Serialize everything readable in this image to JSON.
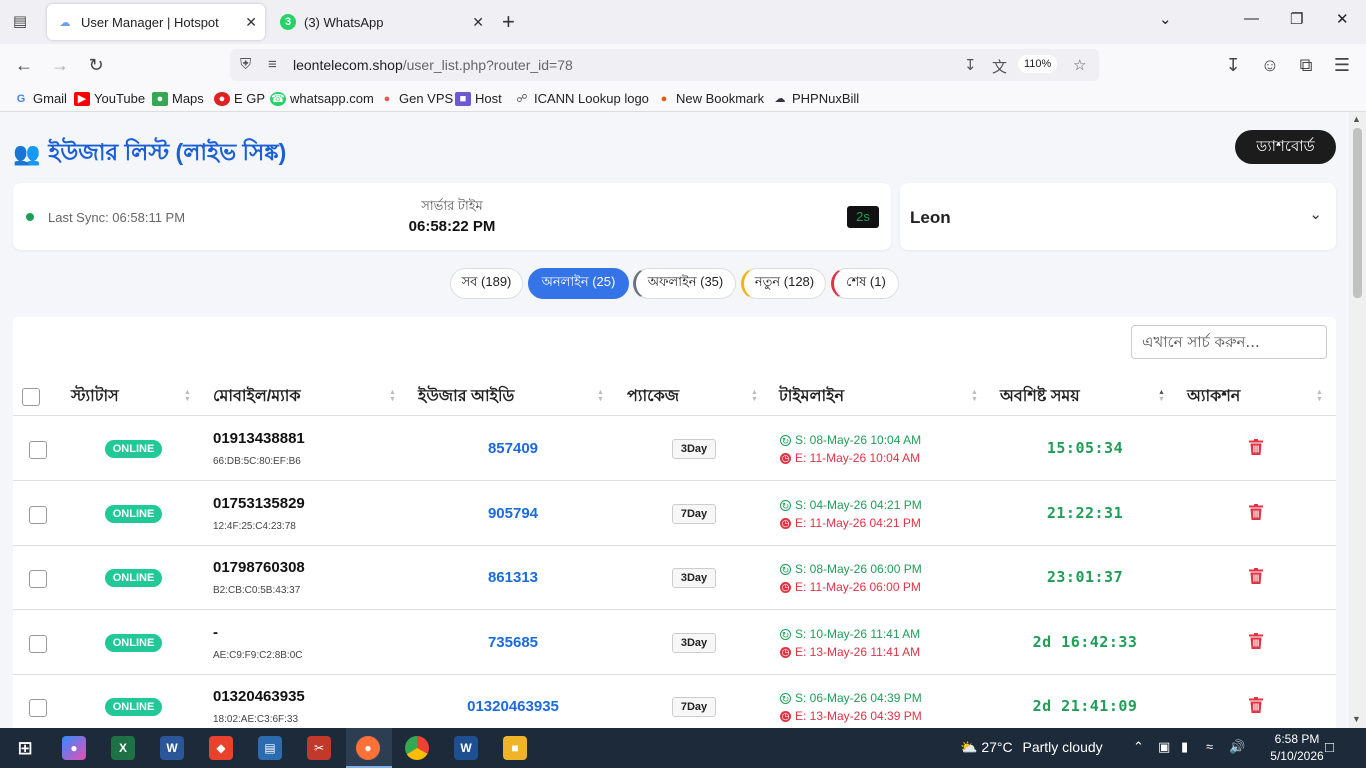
{
  "browser": {
    "tabs": [
      {
        "title": "User Manager | Hotspot",
        "active": true
      },
      {
        "title": "(3) WhatsApp",
        "badge": "3",
        "active": false
      }
    ],
    "url_host": "leontelecom.shop",
    "url_path": "/user_list.php?router_id=78",
    "zoom": "110%",
    "bookmarks": [
      "Gmail",
      "YouTube",
      "Maps",
      "E GP",
      "whatsapp.com",
      "Gen VPS",
      "Host",
      "ICANN Lookup logo",
      "New Bookmark",
      "PHPNuxBill"
    ]
  },
  "page": {
    "title": "ইউজার লিস্ট (লাইভ সিঙ্ক)",
    "dashboard_button": "ড্যাশবোর্ড",
    "last_sync": "Last Sync: 06:58:11 PM",
    "server_time_label": "সার্ভার টাইম",
    "server_time": "06:58:22 PM",
    "refresh_countdown": "2s",
    "router": "Leon",
    "filters": [
      {
        "label": "সব (189)"
      },
      {
        "label": "অনলাইন (25)",
        "active": true
      },
      {
        "label": "অফলাইন (35)"
      },
      {
        "label": "নতুন (128)"
      },
      {
        "label": "শেষ (1)"
      }
    ],
    "search_placeholder": "এখানে সার্চ করুন..."
  },
  "table": {
    "headers": {
      "status": "স্ট্যাটাস",
      "mobile": "মোবাইল/ম্যাক",
      "userid": "ইউজার আইডি",
      "package": "প্যাকেজ",
      "timeline": "টাইমলাইন",
      "remaining": "অবশিষ্ট সময়",
      "action": "অ্যাকশন"
    },
    "rows": [
      {
        "status": "ONLINE",
        "mobile": "01913438881",
        "mac": "66:DB:5C:80:EF:B6",
        "userid": "857409",
        "package": "3Day",
        "start": "S: 08-May-26 10:04 AM",
        "end": "E: 11-May-26 10:04 AM",
        "remaining": "15:05:34"
      },
      {
        "status": "ONLINE",
        "mobile": "01753135829",
        "mac": "12:4F:25:C4:23:78",
        "userid": "905794",
        "package": "7Day",
        "start": "S: 04-May-26 04:21 PM",
        "end": "E: 11-May-26 04:21 PM",
        "remaining": "21:22:31"
      },
      {
        "status": "ONLINE",
        "mobile": "01798760308",
        "mac": "B2:CB:C0:5B:43:37",
        "userid": "861313",
        "package": "3Day",
        "start": "S: 08-May-26 06:00 PM",
        "end": "E: 11-May-26 06:00 PM",
        "remaining": "23:01:37"
      },
      {
        "status": "ONLINE",
        "mobile": "-",
        "mac": "AE:C9:F9:C2:8B:0C",
        "userid": "735685",
        "package": "3Day",
        "start": "S: 10-May-26 11:41 AM",
        "end": "E: 13-May-26 11:41 AM",
        "remaining": "2d 16:42:33"
      },
      {
        "status": "ONLINE",
        "mobile": "01320463935",
        "mac": "18:02:AE:C3:6F:33",
        "userid": "01320463935",
        "package": "7Day",
        "start": "S: 06-May-26 04:39 PM",
        "end": "E: 13-May-26 04:39 PM",
        "remaining": "2d 21:41:09"
      }
    ]
  },
  "taskbar": {
    "weather_temp": "27°C",
    "weather_desc": "Partly cloudy",
    "time": "6:58 PM",
    "date": "5/10/2026"
  },
  "colors": {
    "accent": "#1a5fd8",
    "online": "#20c997",
    "start_green": "#1e9e57",
    "end_red": "#e03344"
  }
}
